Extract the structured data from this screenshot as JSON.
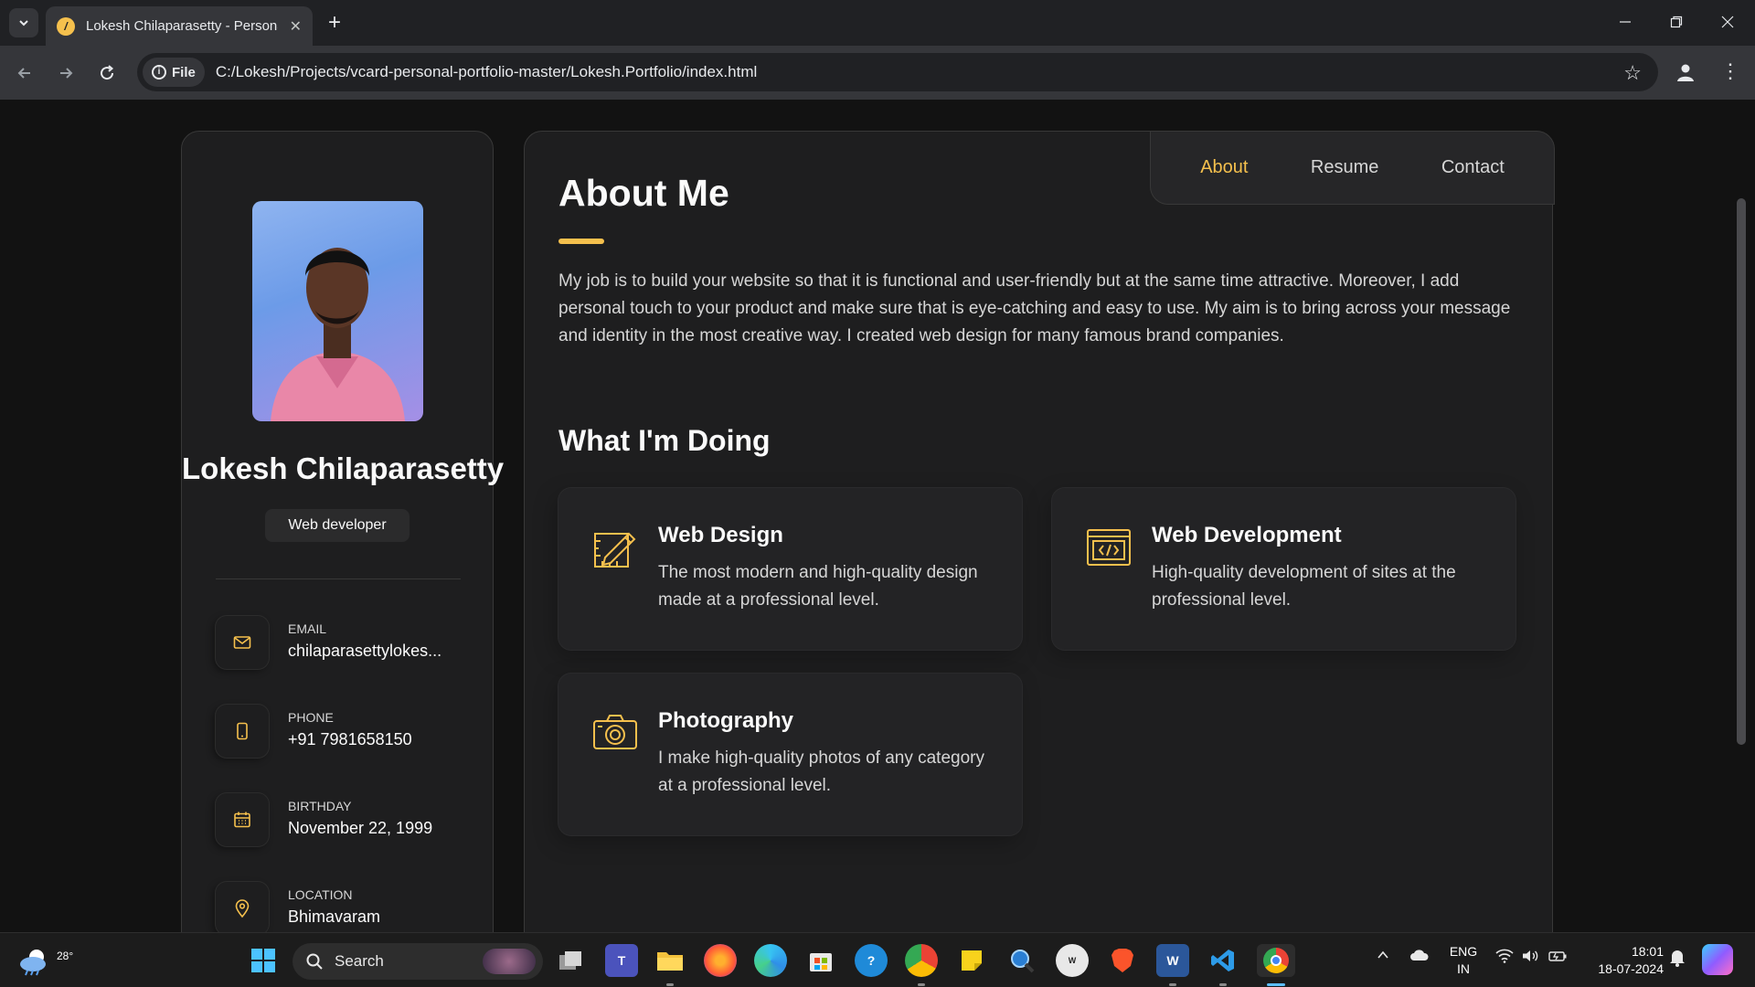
{
  "browser": {
    "tab_title": "Lokesh Chilaparasetty - Personal vCard",
    "site_chip_label": "File",
    "url": "C:/Lokesh/Projects/vcard-personal-portfolio-master/Lokesh.Portfolio/index.html"
  },
  "sidebar": {
    "name": "Lokesh Chilaparasetty",
    "title": "Web developer",
    "contacts": [
      {
        "label": "Email",
        "value": "chilaparasettylokes..."
      },
      {
        "label": "Phone",
        "value": "+91 7981658150"
      },
      {
        "label": "Birthday",
        "value": "November 22, 1999"
      },
      {
        "label": "Location",
        "value": "Bhimavaram"
      }
    ]
  },
  "navbar": {
    "items": [
      "About",
      "Resume",
      "Contact"
    ],
    "active": "About"
  },
  "about": {
    "heading": "About Me",
    "text": "My job is to build your website so that it is functional and user-friendly but at the same time attractive. Moreover, I add personal touch to your product and make sure that is eye-catching and easy to use. My aim is to bring across your message and identity in the most creative way. I created web design for many famous brand companies.",
    "doing_heading": "What I'm Doing",
    "services": [
      {
        "title": "Web Design",
        "text": "The most modern and high-quality design made at a professional level.",
        "icon": "design-icon"
      },
      {
        "title": "Web Development",
        "text": "High-quality development of sites at the professional level.",
        "icon": "code-icon"
      },
      {
        "title": "Photography",
        "text": "I make high-quality photos of any category at a professional level.",
        "icon": "camera-icon"
      }
    ]
  },
  "taskbar": {
    "temperature": "28°",
    "search_placeholder": "Search",
    "lang_line1": "ENG",
    "lang_line2": "IN",
    "time": "18:01",
    "date": "18-07-2024"
  },
  "colors": {
    "accent": "#f5c04d",
    "page_bg": "#121212",
    "card_bg": "#1e1e1f"
  }
}
